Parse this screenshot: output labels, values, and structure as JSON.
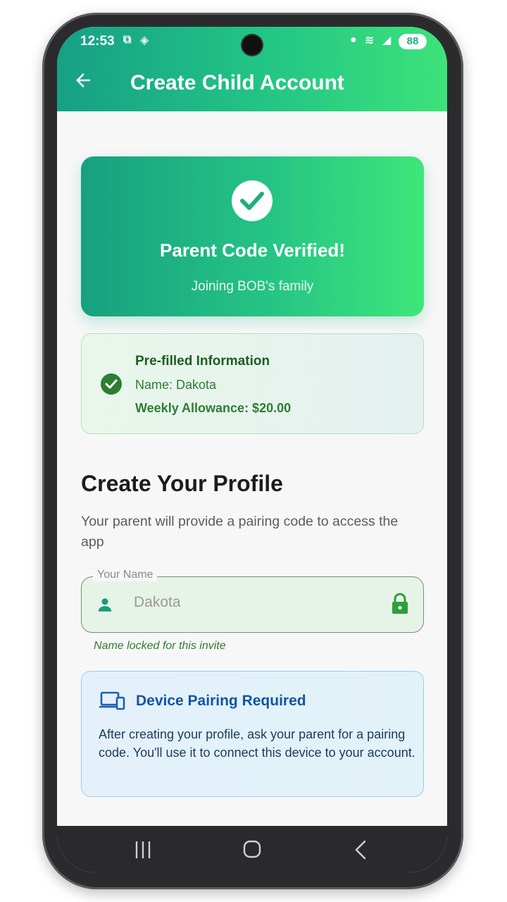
{
  "status_bar": {
    "time": "12:53",
    "battery": "88"
  },
  "app_bar": {
    "title": "Create Child Account",
    "back_icon": "arrow-left-icon"
  },
  "verified_card": {
    "title": "Parent Code Verified!",
    "subtitle": "Joining BOB's family",
    "icon": "check-circle-icon"
  },
  "prefill": {
    "title": "Pre-filled Information",
    "name_line": "Name: Dakota",
    "allowance_line": "Weekly Allowance: $20.00"
  },
  "profile": {
    "heading": "Create Your Profile",
    "description": "Your parent will provide a pairing code to access the app"
  },
  "name_field": {
    "label": "Your Name",
    "value": "Dakota",
    "helper": "Name locked for this invite",
    "leading_icon": "person-icon",
    "trailing_icon": "lock-icon"
  },
  "pairing_card": {
    "title": "Device Pairing Required",
    "body": "After creating your profile, ask your parent for a pairing code. You'll use it to connect this device to your account.",
    "icon": "devices-icon"
  },
  "colors": {
    "primary_start": "#16a085",
    "primary_end": "#3de27a",
    "success_green": "#2e7d32",
    "info_blue": "#1553a6"
  }
}
